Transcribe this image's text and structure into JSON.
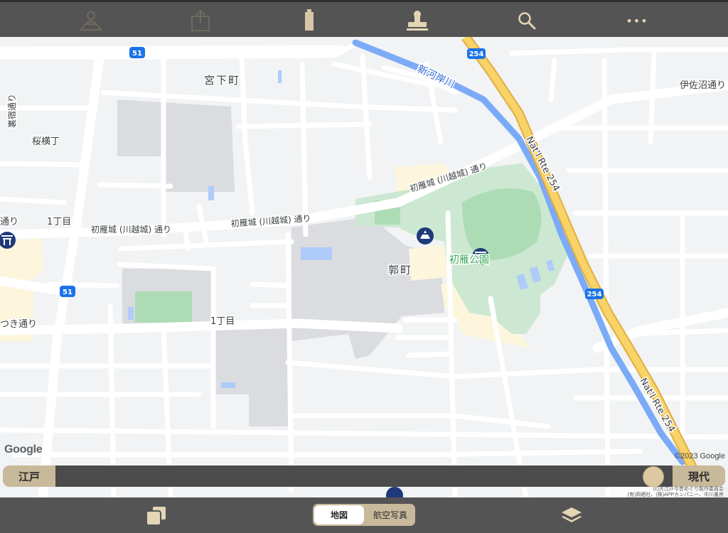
{
  "toolbar": {
    "icons": [
      "user-location-icon",
      "share-icon",
      "bookmark-icon",
      "stamp-icon",
      "search-icon",
      "more-icon"
    ],
    "more_label": "•••"
  },
  "map": {
    "labels": {
      "miyashita": "宮下町",
      "shinkashigawa": "新河岸川",
      "isanuma": "伊佐沼通り",
      "urajuku": "裏宿通り",
      "sakurayoko": "桜横丁",
      "hatsukari_1": "初雁城 (川越城) 通り",
      "hatsukari_2": "初雁城 (川越城) 通り",
      "hatsukari_3": "初雁城 (川越城) 通り",
      "chome1_a": "1丁目",
      "chome1_b": "1丁目",
      "dori_left": "通り",
      "kuruwamachi": "郭町",
      "hatsukari_park": "初雁公園",
      "tsuki_dori": "つき通り",
      "nat_rte_1": "Nat'l Rte 254",
      "nat_rte_2": "Nat'l Rte 254"
    },
    "route_shields": {
      "r51a": "51",
      "r51b": "51",
      "r254a": "254",
      "r254b": "254"
    }
  },
  "slider": {
    "left_label": "江戸",
    "right_label": "現代",
    "value_fraction": 0.95
  },
  "segment": {
    "map_label": "地図",
    "aerial_label": "航空写真",
    "selected": "地図"
  },
  "attribution": {
    "google": "Google",
    "copyright": "©2023 Google",
    "line1": "(c)大江戸今昔めぐり製作委員会",
    "line2": "(有)両晒社、(株)APPカンパニー、中川書房"
  },
  "colors": {
    "bar": "#555455",
    "accent": "#c8b99b",
    "park": "#cde8d2",
    "route": "#f7d368",
    "river": "#7baaf7"
  }
}
